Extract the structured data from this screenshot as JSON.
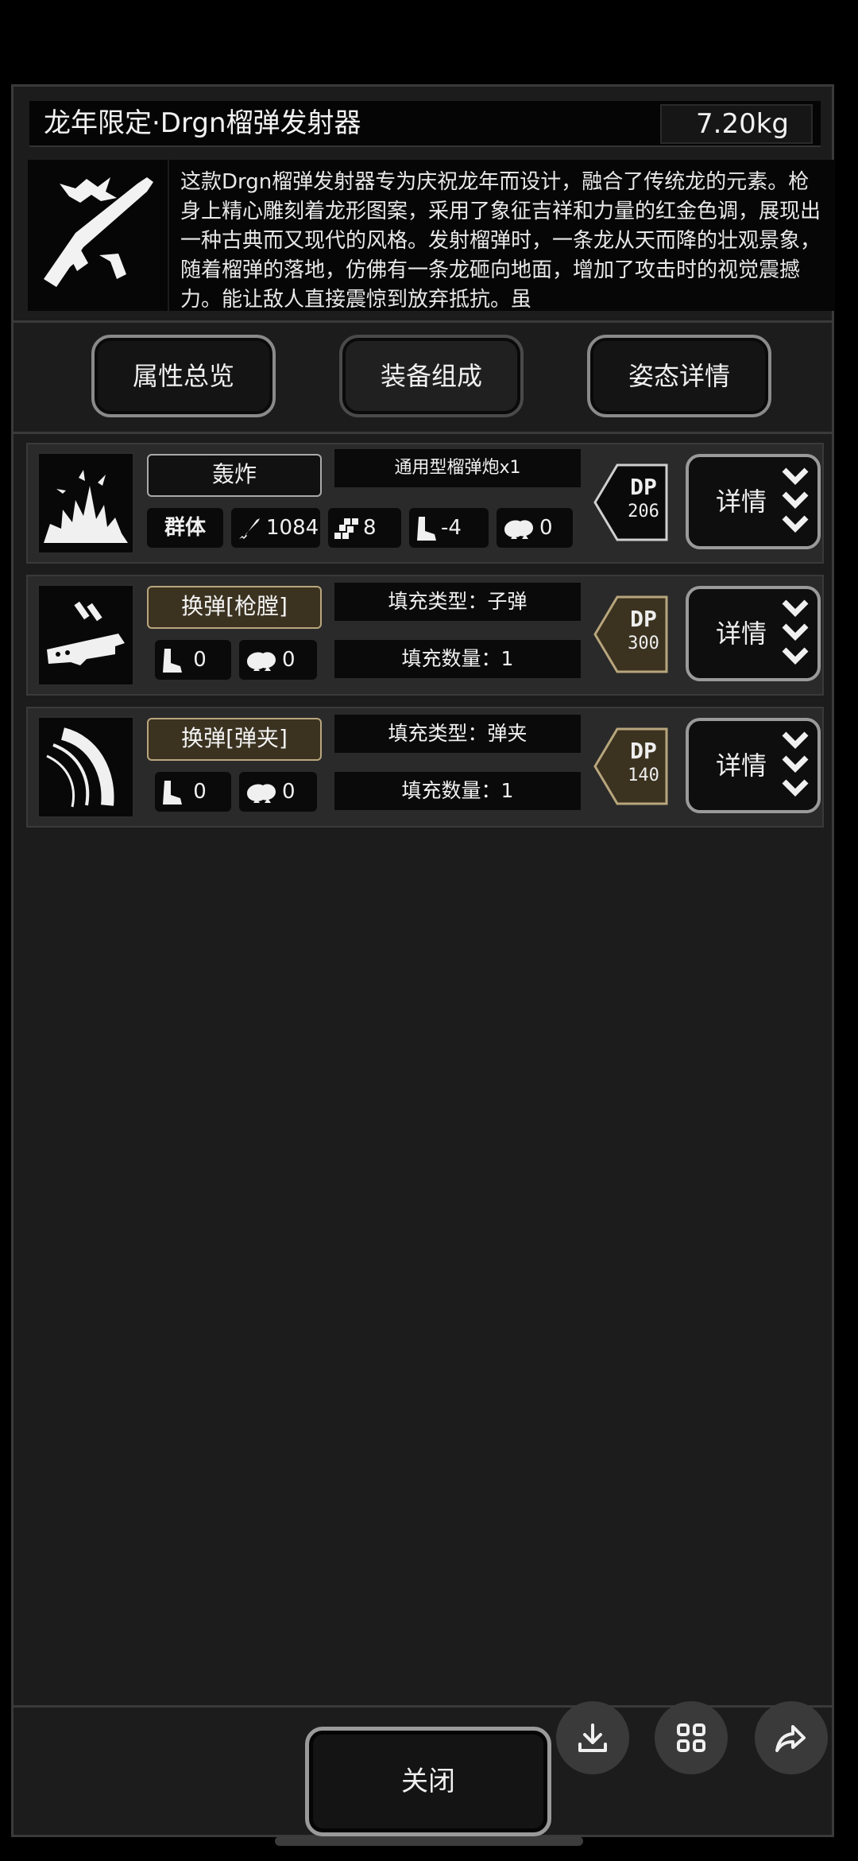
{
  "header": {
    "title": "龙年限定·Drgn榴弹发射器",
    "weight": "7.20kg"
  },
  "item": {
    "icon": "dragon-grenade-launcher-icon",
    "description": "这款Drgn榴弹发射器专为庆祝龙年而设计，融合了传统龙的元素。枪身上精心雕刻着龙形图案，采用了象征吉祥和力量的红金色调，展现出一种古典而又现代的风格。发射榴弹时，一条龙从天而降的壮观景象，随着榴弹的落地，仿佛有一条龙砸向地面，增加了攻击时的视觉震撼力。能让敌人直接震惊到放弃抵抗。虽"
  },
  "tabs": [
    {
      "label": "属性总览"
    },
    {
      "label": "装备组成"
    },
    {
      "label": "姿态详情"
    }
  ],
  "rows": [
    {
      "icon": "explosion-icon",
      "name": "轰炸",
      "info1": "通用型榴弹炮x1",
      "stats": {
        "target": "群体",
        "attack": "1084",
        "speed": "8",
        "move": "-4",
        "noise": "0"
      },
      "dp_label": "DP",
      "dp_value": "206",
      "detail_label": "详情"
    },
    {
      "icon": "reload-chamber-icon",
      "name": "换弹[枪膛]",
      "info1": "填充类型：子弹",
      "info2": "填充数量：1",
      "stats": {
        "move": "0",
        "noise": "0"
      },
      "dp_label": "DP",
      "dp_value": "300",
      "detail_label": "详情"
    },
    {
      "icon": "reload-magazine-icon",
      "name": "换弹[弹夹]",
      "info1": "填充类型：弹夹",
      "info2": "填充数量：1",
      "stats": {
        "move": "0",
        "noise": "0"
      },
      "dp_label": "DP",
      "dp_value": "140",
      "detail_label": "详情"
    }
  ],
  "footer": {
    "close_label": "关闭"
  },
  "floating_actions": [
    "download-icon",
    "grid-icon",
    "share-icon"
  ],
  "colors": {
    "panel_bg": "#1c1c1c",
    "accent_gold": "#b8a67d"
  }
}
